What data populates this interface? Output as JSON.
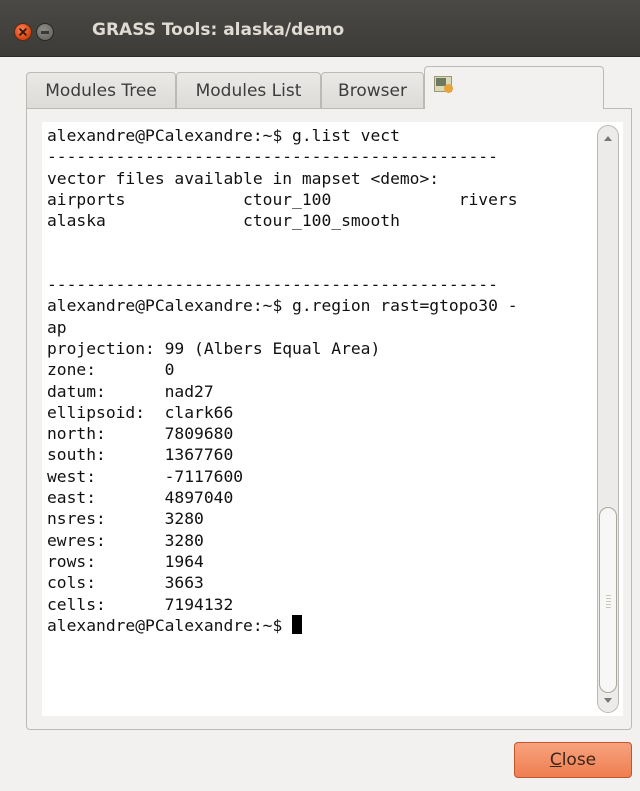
{
  "window": {
    "title": "GRASS Tools: alaska/demo"
  },
  "tabs": [
    {
      "label": "Modules Tree"
    },
    {
      "label": "Modules List"
    },
    {
      "label": "Browser"
    },
    {
      "label": "",
      "icon": "shell-icon"
    }
  ],
  "console": {
    "lines": [
      "alexandre@PCalexandre:~$ g.list vect",
      "----------------------------------------------",
      "vector files available in mapset <demo>:",
      "airports            ctour_100             rivers",
      "alaska              ctour_100_smooth",
      "",
      "",
      "----------------------------------------------",
      "alexandre@PCalexandre:~$ g.region rast=gtopo30 -",
      "ap",
      "projection: 99 (Albers Equal Area)",
      "zone:       0",
      "datum:      nad27",
      "ellipsoid:  clark66",
      "north:      7809680",
      "south:      1367760",
      "west:       -7117600",
      "east:       4897040",
      "nsres:      3280",
      "ewres:      3280",
      "rows:       1964",
      "cols:       3663",
      "cells:      7194132"
    ],
    "prompt": "alexandre@PCalexandre:~$ "
  },
  "buttons": {
    "close_mnemonic": "C",
    "close_rest": "lose"
  },
  "colors": {
    "titlebar": "#3c3b37",
    "close_button": "#ef7e50"
  }
}
